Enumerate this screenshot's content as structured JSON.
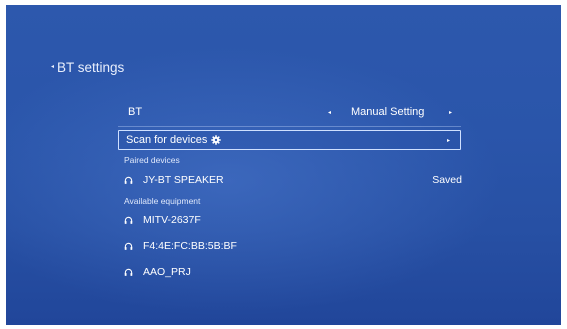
{
  "header": {
    "back_arrow": "◂",
    "title": "BT settings"
  },
  "bt_row": {
    "label": "BT",
    "arrow_left": "◂",
    "value": "Manual Setting",
    "arrow_right": "▸"
  },
  "scan": {
    "label": "Scan for devices",
    "icon": "gear-icon",
    "arrow_right": "▸"
  },
  "paired": {
    "section_label": "Paired devices",
    "devices": [
      {
        "name": "JY-BT SPEAKER",
        "status": "Saved",
        "icon": "headphones-icon"
      }
    ]
  },
  "available": {
    "section_label": "Available equipment",
    "devices": [
      {
        "name": "MITV-2637F",
        "icon": "headphones-icon"
      },
      {
        "name": "F4:4E:FC:BB:5B:BF",
        "icon": "headphones-icon"
      },
      {
        "name": "AAO_PRJ",
        "icon": "headphones-icon"
      }
    ]
  },
  "colors": {
    "background": "#2a55aa",
    "text": "#ffffff",
    "focus_border": "#cfe0ff"
  }
}
